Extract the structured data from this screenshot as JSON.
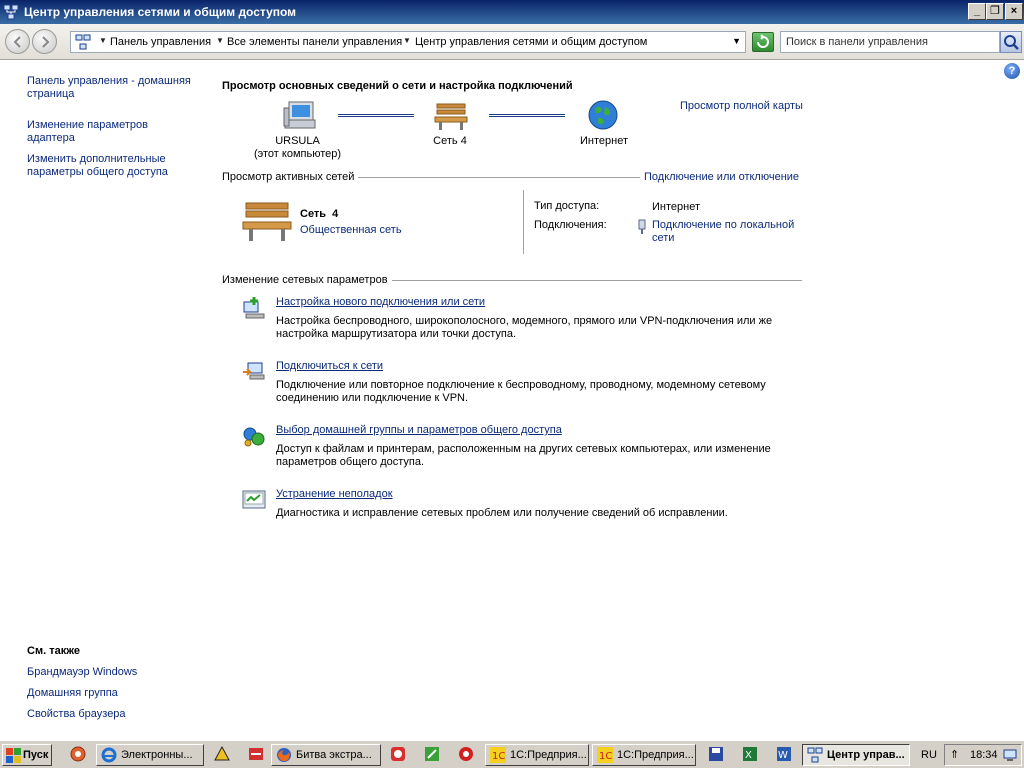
{
  "window": {
    "title": "Центр управления сетями и общим доступом"
  },
  "addressbar": {
    "breadcrumb": [
      "Панель управления",
      "Все элементы панели управления",
      "Центр управления сетями и общим доступом"
    ],
    "search_placeholder": "Поиск в панели управления"
  },
  "sidebar": {
    "links": [
      "Панель управления - домашняя страница",
      "Изменение параметров адаптера",
      "Изменить дополнительные параметры общего доступа"
    ],
    "see_also_title": "См. также",
    "see_also": [
      "Брандмауэр Windows",
      "Домашняя группа",
      "Свойства браузера"
    ]
  },
  "main": {
    "heading": "Просмотр основных сведений о сети и настройка подключений",
    "full_map_link": "Просмотр полной карты",
    "map": {
      "computer_name": "URSULA",
      "computer_sub": "(этот компьютер)",
      "network": "Сеть  4",
      "internet": "Интернет"
    },
    "active_networks": {
      "title": "Просмотр активных сетей",
      "connect_link": "Подключение или отключение",
      "network_name": "Сеть  4",
      "network_type": "Общественная сеть",
      "access_label": "Тип доступа:",
      "access_value": "Интернет",
      "connections_label": "Подключения:",
      "connections_value": "Подключение по локальной сети"
    },
    "change_settings": {
      "title": "Изменение сетевых параметров",
      "tasks": [
        {
          "title": "Настройка нового подключения или сети",
          "desc": "Настройка беспроводного, широкополосного, модемного, прямого или VPN-подключения или же настройка маршрутизатора или точки доступа."
        },
        {
          "title": "Подключиться к сети",
          "desc": "Подключение или повторное подключение к беспроводному, проводному, модемному сетевому соединению или подключение к VPN."
        },
        {
          "title": "Выбор домашней группы и параметров общего доступа",
          "desc": "Доступ к файлам и принтерам, расположенным на других сетевых компьютерах, или изменение параметров общего доступа."
        },
        {
          "title": "Устранение неполадок",
          "desc": "Диагностика и исправление сетевых проблем или получение сведений об исправлении."
        }
      ]
    }
  },
  "taskbar": {
    "start_label": "Пуск",
    "tasks": [
      "Электронны...",
      "Битва экстра...",
      "1С:Предприя...",
      "1С:Предприя...",
      "Центр управ..."
    ],
    "language": "RU",
    "time": "18:34"
  },
  "colors": {
    "title_bar": "#0a246a",
    "link": "#0b2a7a",
    "taskbar": "#d4d0c8"
  }
}
